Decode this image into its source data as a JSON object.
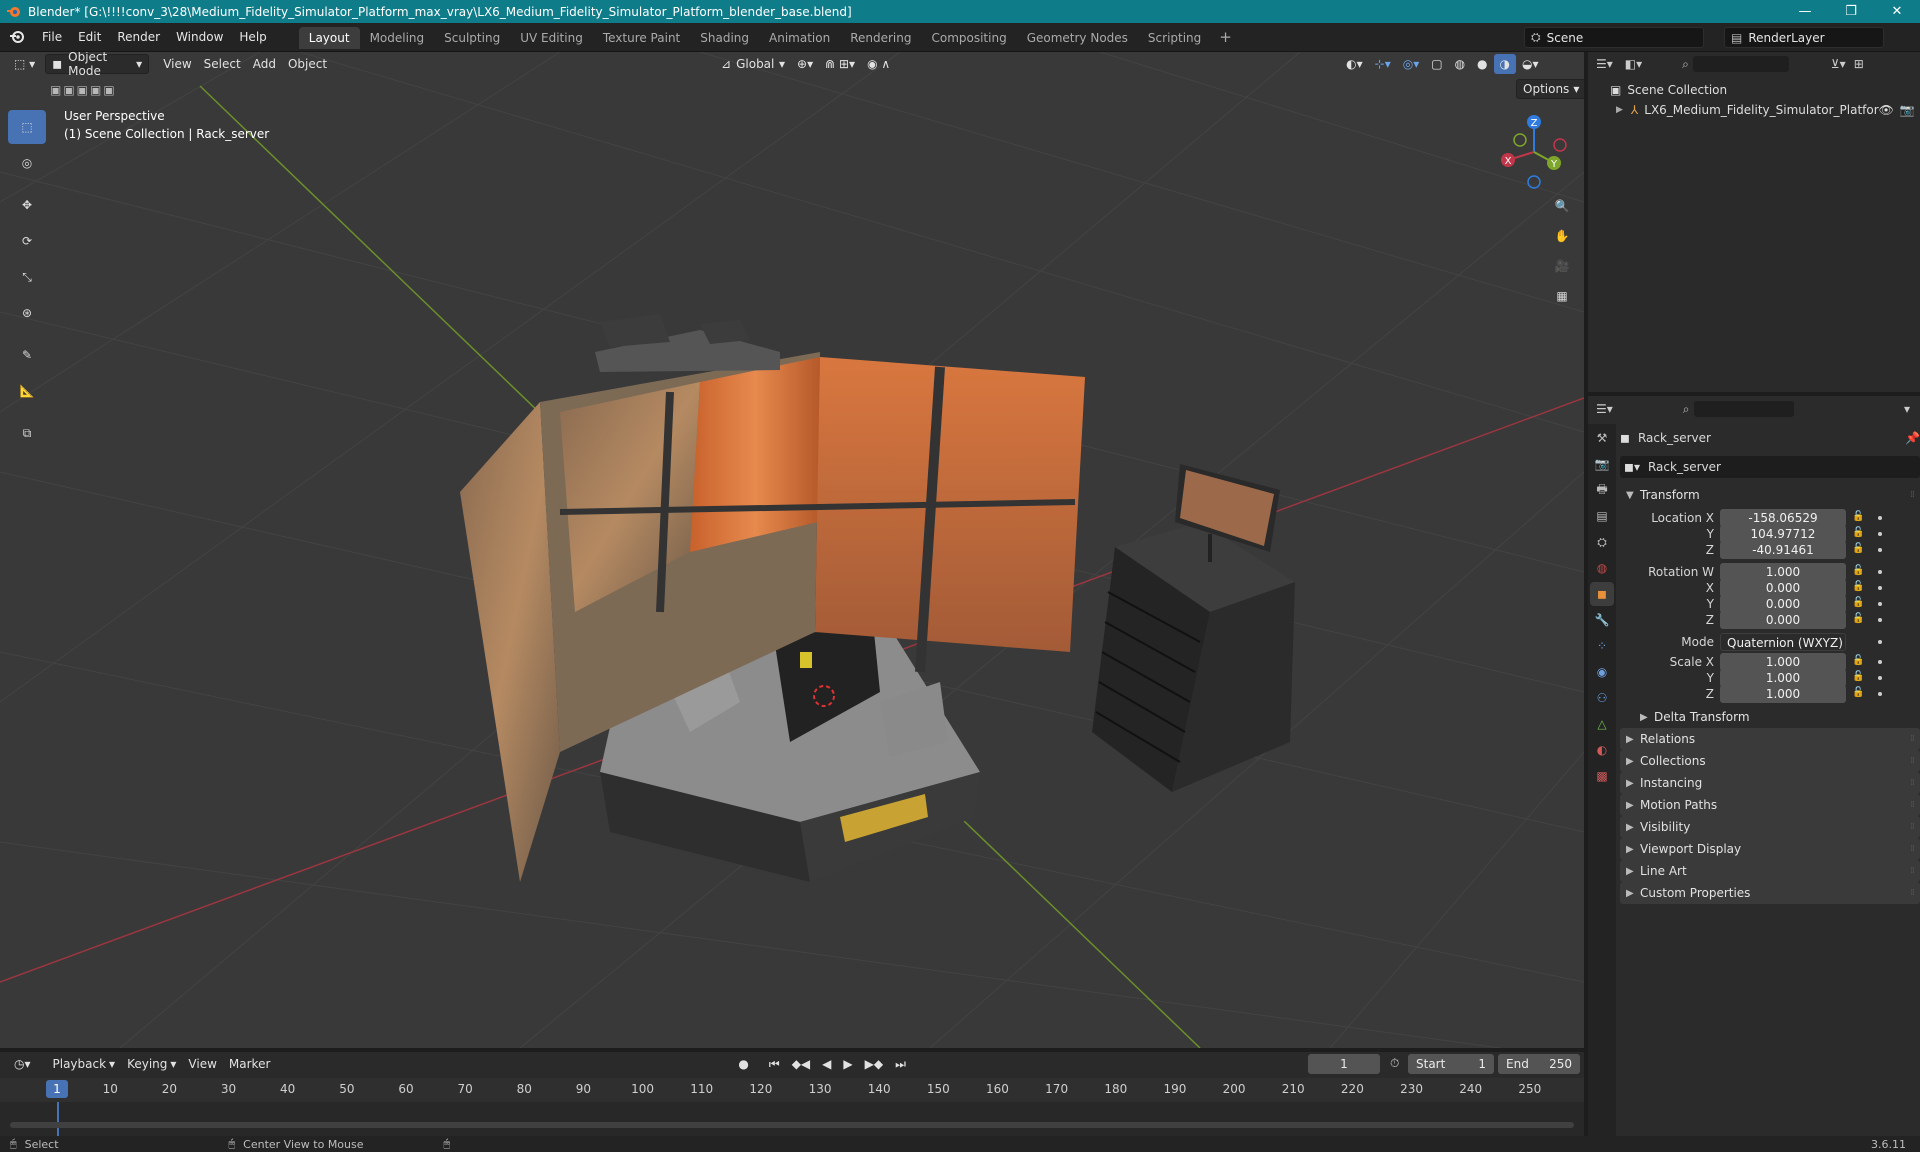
{
  "window": {
    "title": "Blender* [G:\\!!!!conv_3\\28\\Medium_Fidelity_Simulator_Platform_max_vray\\LX6_Medium_Fidelity_Simulator_Platform_blender_base.blend]",
    "minimize": "—",
    "maximize": "❐",
    "close": "✕"
  },
  "menu": {
    "items": [
      "File",
      "Edit",
      "Render",
      "Window",
      "Help"
    ],
    "workspaces": [
      "Layout",
      "Modeling",
      "Sculpting",
      "UV Editing",
      "Texture Paint",
      "Shading",
      "Animation",
      "Rendering",
      "Compositing",
      "Geometry Nodes",
      "Scripting"
    ],
    "active_workspace": "Layout",
    "add_workspace": "+",
    "scene": "Scene",
    "view_layer": "RenderLayer"
  },
  "viewport": {
    "mode": "Object Mode",
    "menus": [
      "View",
      "Select",
      "Add",
      "Object"
    ],
    "orientation": "Global",
    "options": "Options",
    "perspective_label": "User Perspective",
    "collection_label": "(1) Scene Collection | Rack_server",
    "gizmo": {
      "x": "X",
      "y": "Y",
      "z": "Z"
    },
    "colors": {
      "x_axis": "#c2364a",
      "y_axis": "#7da62a",
      "z_axis": "#2f7be0",
      "accent": "#4772b3"
    }
  },
  "outliner": {
    "root": "Scene Collection",
    "items": [
      {
        "label": "LX6_Medium_Fidelity_Simulator_Platfor"
      }
    ]
  },
  "properties": {
    "object_name": "Rack_server",
    "data_name": "Rack_server",
    "transform_title": "Transform",
    "location": {
      "label": "Location X",
      "x": "-158.06529",
      "y": "104.97712",
      "z": "-40.91461"
    },
    "rotation": {
      "label": "Rotation W",
      "w": "1.000",
      "x": "0.000",
      "y": "0.000",
      "z": "0.000"
    },
    "mode_label": "Mode",
    "mode_value": "Quaternion (WXYZ)",
    "scale": {
      "label": "Scale X",
      "x": "1.000",
      "y": "1.000",
      "z": "1.000"
    },
    "axis_labels": {
      "x": "X",
      "y": "Y",
      "z": "Z"
    },
    "delta_transform": "Delta Transform",
    "panels": [
      "Relations",
      "Collections",
      "Instancing",
      "Motion Paths",
      "Visibility",
      "Viewport Display",
      "Line Art",
      "Custom Properties"
    ]
  },
  "timeline": {
    "menus": [
      "Playback",
      "Keying",
      "View",
      "Marker"
    ],
    "current_frame": "1",
    "start_label": "Start",
    "start": "1",
    "end_label": "End",
    "end": "250",
    "ticks": [
      "10",
      "20",
      "30",
      "40",
      "50",
      "60",
      "70",
      "80",
      "90",
      "100",
      "110",
      "120",
      "130",
      "140",
      "150",
      "160",
      "170",
      "180",
      "190",
      "200",
      "210",
      "220",
      "230",
      "240",
      "250"
    ]
  },
  "status": {
    "select": "Select",
    "center_view": "Center View to Mouse",
    "version": "3.6.11"
  }
}
